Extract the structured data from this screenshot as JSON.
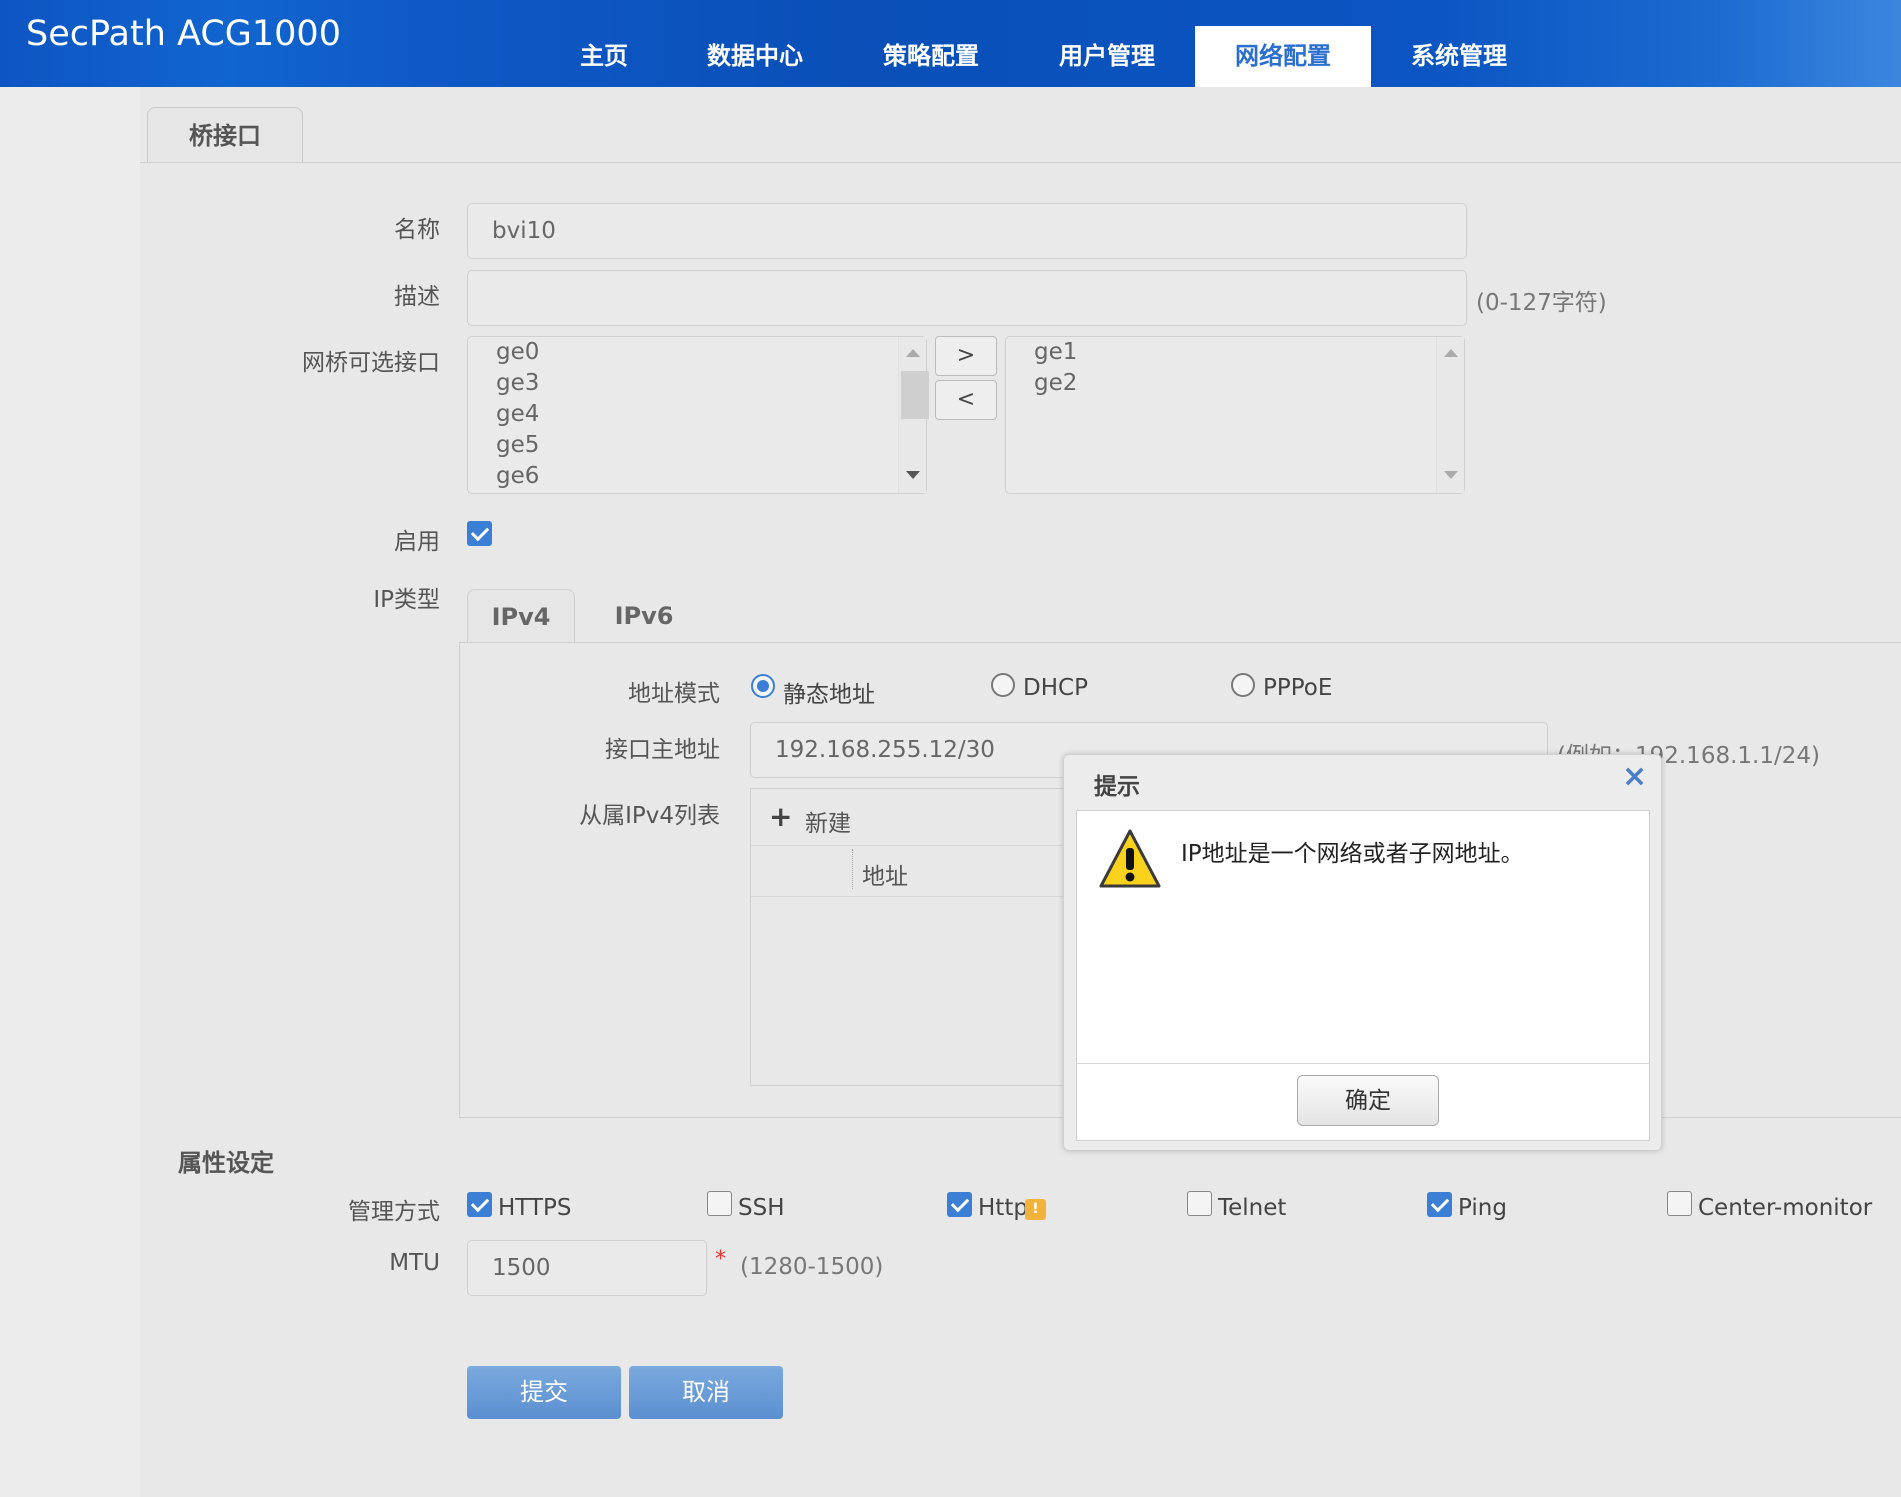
{
  "header": {
    "brand": "SecPath ACG1000",
    "nav": [
      "主页",
      "数据中心",
      "策略配置",
      "用户管理",
      "网络配置",
      "系统管理"
    ],
    "active_nav": "网络配置"
  },
  "page_tab": "桥接口",
  "form": {
    "name_label": "名称",
    "name_value": "bvi10",
    "desc_label": "描述",
    "desc_value": "",
    "desc_hint": "(0-127字符)",
    "ifaces_label": "网桥可选接口",
    "available": [
      "ge0",
      "ge3",
      "ge4",
      "ge5",
      "ge6"
    ],
    "selected": [
      "ge1",
      "ge2"
    ],
    "add_btn": ">",
    "remove_btn": "<",
    "enable_label": "启用",
    "enable_checked": true,
    "iptype_label": "IP类型",
    "ip_tabs": [
      "IPv4",
      "IPv6"
    ]
  },
  "ipv4": {
    "mode_label": "地址模式",
    "modes": [
      "静态地址",
      "DHCP",
      "PPPoE"
    ],
    "selected_mode": "静态地址",
    "addr_label": "接口主地址",
    "addr_value": "192.168.255.12/30",
    "addr_hint": "(例如：192.168.1.1/24)",
    "secondary_label": "从属IPv4列表",
    "new_btn": "新建",
    "col_addr": "地址"
  },
  "attrs": {
    "section_title": "属性设定",
    "mgmt_label": "管理方式",
    "mgmt": [
      {
        "label": "HTTPS",
        "checked": true
      },
      {
        "label": "SSH",
        "checked": false
      },
      {
        "label": "Http",
        "checked": true
      },
      {
        "label": "Telnet",
        "checked": false
      },
      {
        "label": "Ping",
        "checked": true
      },
      {
        "label": "Center-monitor",
        "checked": false
      }
    ],
    "mtu_label": "MTU",
    "mtu_value": "1500",
    "mtu_required": "*",
    "mtu_hint": "(1280-1500)"
  },
  "actions": {
    "submit": "提交",
    "cancel": "取消"
  },
  "dialog": {
    "title": "提示",
    "message": "IP地址是一个网络或者子网地址。",
    "ok": "确定",
    "close": "×"
  },
  "colors": {
    "header": "#0b55c2",
    "accent": "#3a7fd5",
    "button": "#5b8fd0"
  }
}
